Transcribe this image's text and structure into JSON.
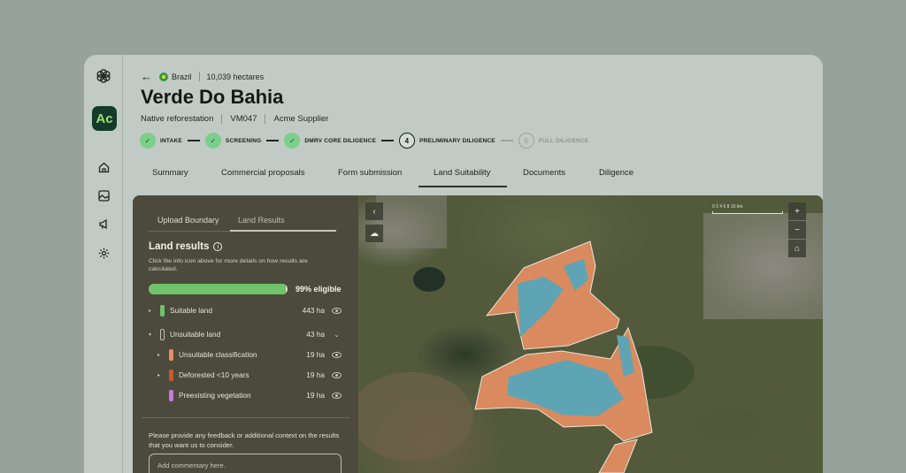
{
  "header": {
    "country": "Brazil",
    "area": "10,039 hectares",
    "title": "Verde Do Bahia",
    "meta": [
      "Native reforestation",
      "VM047",
      "Acme Supplier"
    ]
  },
  "rail": {
    "logo_text": "Ac"
  },
  "steps": [
    {
      "label": "INTAKE",
      "state": "done",
      "marker": "✓"
    },
    {
      "label": "SCREENING",
      "state": "done",
      "marker": "✓"
    },
    {
      "label": "DMRV CORE DILIGENCE",
      "state": "done",
      "marker": "✓"
    },
    {
      "label": "PRELIMINARY DILIGENCE",
      "state": "active",
      "marker": "4"
    },
    {
      "label": "FULL DILIGENCE",
      "state": "future",
      "marker": "5"
    }
  ],
  "tabs": [
    "Summary",
    "Commercial proposals",
    "Form submission",
    "Land Suitability",
    "Documents",
    "Diligence"
  ],
  "active_tab": "Land Suitability",
  "side_panel": {
    "subtabs": [
      "Upload Boundary",
      "Land Results"
    ],
    "active_subtab": "Land Results",
    "title": "Land results",
    "description": "Click the info icon above for more details on how results are calculated.",
    "eligible_fraction": 0.99,
    "eligible_label": "99% eligible",
    "rows": [
      {
        "label": "Suitable land",
        "value": "443 ha",
        "color": "#6fc36a",
        "caret": "▸",
        "indent": false
      },
      {
        "label": "Unsuitable land",
        "value": "43 ha",
        "color": "outline",
        "caret": "▾",
        "indent": false
      },
      {
        "label": "Unsuitable classification",
        "value": "19 ha",
        "color": "#e58f62",
        "caret": "▸",
        "indent": true
      },
      {
        "label": "Deforested <10 years",
        "value": "19 ha",
        "color": "#c9582b",
        "caret": "▸",
        "indent": true
      },
      {
        "label": "Preexisting vegetation",
        "value": "19 ha",
        "color": "#c97ad6",
        "caret": "",
        "indent": true
      }
    ],
    "feedback_prompt": "Please provide any feedback or additional context on the results that you want us to consider.",
    "comment_placeholder": "Add commentary here."
  },
  "map": {
    "zoom_in": "+",
    "zoom_out": "−",
    "scale_label": "0   2   4   6   8   10 km"
  }
}
